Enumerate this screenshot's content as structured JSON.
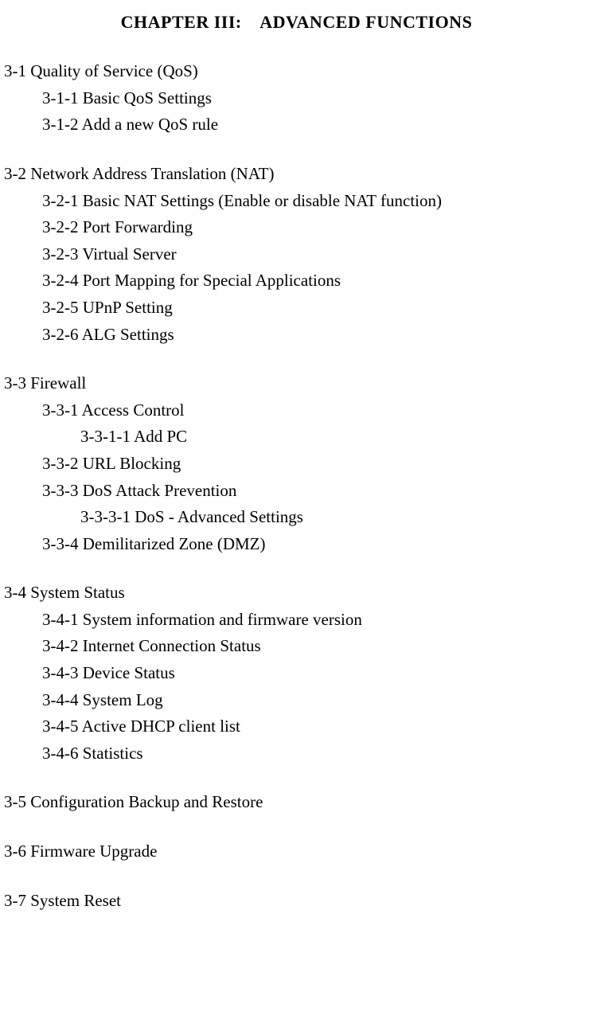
{
  "heading": "CHAPTER III: ADVANCED FUNCTIONS",
  "sections": [
    {
      "entries": [
        {
          "level": 0,
          "num": "3-1",
          "title": "Quality of Service (QoS)"
        },
        {
          "level": 1,
          "num": "3-1-1",
          "title": "Basic QoS Settings"
        },
        {
          "level": 1,
          "num": "3-1-2",
          "title": "Add a new QoS rule"
        }
      ]
    },
    {
      "entries": [
        {
          "level": 0,
          "num": "3-2",
          "title": "Network Address Translation (NAT)"
        },
        {
          "level": 1,
          "num": "3-2-1",
          "title": "Basic NAT Settings (Enable or disable NAT function)"
        },
        {
          "level": 1,
          "num": "3-2-2",
          "title": "Port Forwarding"
        },
        {
          "level": 1,
          "num": "3-2-3",
          "title": "Virtual Server"
        },
        {
          "level": 1,
          "num": "3-2-4",
          "title": "Port Mapping for Special Applications"
        },
        {
          "level": 1,
          "num": "3-2-5",
          "title": "UPnP Setting"
        },
        {
          "level": 1,
          "num": "3-2-6",
          "title": "ALG Settings"
        }
      ]
    },
    {
      "entries": [
        {
          "level": 0,
          "num": "3-3",
          "title": "Firewall"
        },
        {
          "level": 1,
          "num": "3-3-1",
          "title": "Access Control"
        },
        {
          "level": 2,
          "num": "3-3-1-1",
          "title": "Add PC"
        },
        {
          "level": 1,
          "num": "3-3-2",
          "title": "URL Blocking"
        },
        {
          "level": 1,
          "num": "3-3-3",
          "title": "DoS Attack Prevention"
        },
        {
          "level": 2,
          "num": "3-3-3-1",
          "title": "DoS - Advanced Settings"
        },
        {
          "level": 1,
          "num": "3-3-4",
          "title": "Demilitarized Zone (DMZ)"
        }
      ]
    },
    {
      "entries": [
        {
          "level": 0,
          "num": "3-4",
          "title": "System Status"
        },
        {
          "level": 1,
          "num": "3-4-1",
          "title": "System information and firmware version"
        },
        {
          "level": 1,
          "num": "3-4-2",
          "title": "Internet Connection Status"
        },
        {
          "level": 1,
          "num": "3-4-3",
          "title": "Device Status"
        },
        {
          "level": 1,
          "num": "3-4-4",
          "title": "System Log"
        },
        {
          "level": 1,
          "num": "3-4-5",
          "title": "Active DHCP client list"
        },
        {
          "level": 1,
          "num": "3-4-6",
          "title": "Statistics"
        }
      ]
    },
    {
      "entries": [
        {
          "level": 0,
          "num": "3-5",
          "title": "Configuration Backup and Restore"
        }
      ]
    },
    {
      "entries": [
        {
          "level": 0,
          "num": "3-6",
          "title": "Firmware Upgrade"
        }
      ]
    },
    {
      "entries": [
        {
          "level": 0,
          "num": "3-7",
          "title": "System Reset"
        }
      ]
    }
  ]
}
